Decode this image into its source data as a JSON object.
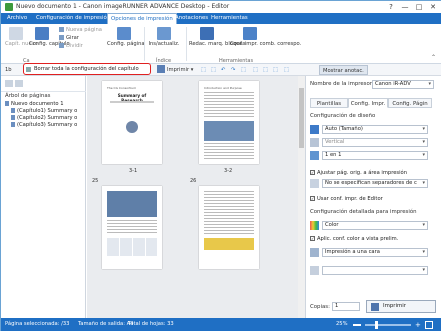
{
  "window": {
    "title": "Nuevo documento 1 - Canon imageRUNNER ADVANCE Desktop - Editor",
    "controls": [
      "?",
      "—",
      "□",
      "✕"
    ]
  },
  "menu": {
    "items": [
      "Archivo",
      "Configuración de impresión",
      "Opciones de impresión",
      "Anotaciones",
      "Herramientas"
    ],
    "active_index": 2
  },
  "ribbon": {
    "buttons": {
      "capit_nuevo": "Capít. nuevo",
      "config_capitulo": "Config. capítulo",
      "nuevo_pagina": "Nueva página",
      "girar": "Girar",
      "dividir": "Dividir",
      "config_pagina": "Config. página",
      "ins_actualiz": "Ins/actualiz.",
      "redac_marq": "Redac. marq. bloques",
      "conf_impr_comb": "Conf. impr. comb. correspo."
    },
    "groups": {
      "capitulo": "Ca",
      "indice": "Índice",
      "herramientas": "Herramientas"
    }
  },
  "toolbar": {
    "tooltip": "Borrar toda la configuración del capítulo",
    "imprimir_label": "Imprimir",
    "mostrar_anotac": "Mostrar anotac.",
    "zoom_marker": "1b"
  },
  "left_pane": {
    "header": "Árbol de páginas",
    "items": [
      "Nuevo documento 1",
      "(Capítulo1) Summary o",
      "(Capítulo2) Summary o",
      "(Capítulo3) Summary o"
    ]
  },
  "center_pane": {
    "page_labels": [
      "3-1",
      "3-2",
      "25",
      "26"
    ],
    "page1": {
      "title": "Summary of Research",
      "header": "The CG Consortium"
    },
    "page2": {
      "header": "Introduction and Purpose"
    }
  },
  "right_pane": {
    "printer_label": "Nombre de la impresora",
    "printer_value": "Canon iR-ADV",
    "tabs": [
      "Plantillas",
      "Config. Impr.",
      "Config. Págin"
    ],
    "active_tab": 1,
    "diseno_label": "Configuración de diseño",
    "auto_tamano": "Auto (Tamaño)",
    "vertical": "Vertical",
    "uno_en_uno": "1 en 1",
    "ajustar_pag": "Ajustar pág. orig. a área impresión",
    "no_se_especif": "No se especifican separadores de c",
    "usar_conf": "Usar conf. impr. de Editor",
    "detallada_label": "Configuración detallada para impresión",
    "color": "Color",
    "aplic_conf": "Aplic. conf. color a vista prelim.",
    "impresion_una_cara": "Impresión a una cara",
    "copias_label": "Copias:",
    "copias_value": "1",
    "imprimir_button": "Imprimir"
  },
  "status": {
    "paginas_sel": "Página seleccionada: /33",
    "tamano_salida": "Tamaño de salida: A4",
    "total_hojas": "Total de hojas: 33",
    "zoom": "25%"
  },
  "colors": {
    "accent": "#1f6fc4",
    "highlight_border": "#e02020"
  }
}
